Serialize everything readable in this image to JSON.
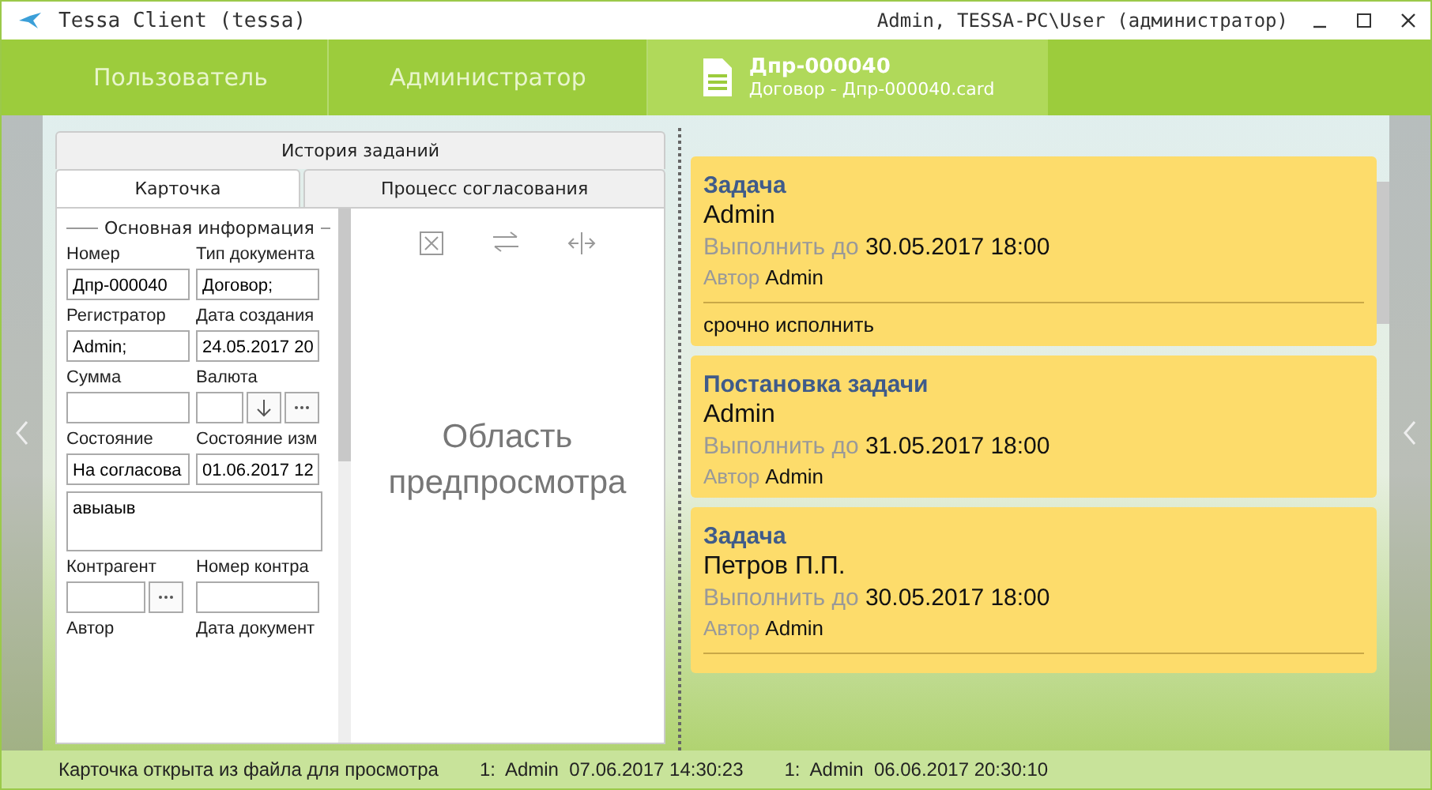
{
  "window": {
    "title": "Tessa Client (tessa)",
    "user": "Admin, TESSA-PC\\User (администратор)"
  },
  "tabs": [
    {
      "label": "Пользователь",
      "selected": false
    },
    {
      "label": "Администратор",
      "selected": false
    },
    {
      "label": "Дпр-000040",
      "subtitle": "Договор - Дпр-000040.card",
      "selected": true
    }
  ],
  "card_tabs_top": [
    {
      "label": "История заданий",
      "selected": false
    }
  ],
  "card_tabs": [
    {
      "label": "Карточка",
      "selected": true
    },
    {
      "label": "Процесс согласования",
      "selected": false
    }
  ],
  "section_title": "Основная информация",
  "fields": [
    {
      "label": "Номер",
      "value": "Дпр-000040",
      "kind": "text"
    },
    {
      "label": "Тип документа",
      "value": "Договор;",
      "kind": "text"
    },
    {
      "label": "Регистратор",
      "value": "Admin;",
      "kind": "text"
    },
    {
      "label": "Дата создания",
      "value": "24.05.2017  20",
      "kind": "text"
    },
    {
      "label": "Сумма",
      "kind": "text"
    },
    {
      "label": "Валюта",
      "kind": "currency"
    },
    {
      "label": "Состояние",
      "value": "На согласова",
      "kind": "text"
    },
    {
      "label": "Состояние изм",
      "value": "01.06.2017  12",
      "kind": "text"
    },
    {
      "value": "авыаыв",
      "kind": "memo"
    },
    {
      "label": "Контрагент",
      "kind": "lookup"
    },
    {
      "label": "Номер контра",
      "kind": "text"
    },
    {
      "label": "Автор",
      "kind": "cut"
    },
    {
      "label": "Дата документ",
      "kind": "cut"
    }
  ],
  "preview": {
    "text": "Область предпросмотра"
  },
  "tasks": [
    {
      "title": "Задача",
      "user": "Admin",
      "due_label": "Выполнить до",
      "due": "30.05.2017 18:00",
      "author_label": "Автор",
      "author": "Admin",
      "comment": "срочно исполнить"
    },
    {
      "title": "Постановка задачи",
      "user": "Admin",
      "due_label": "Выполнить до",
      "due": "31.05.2017 18:00",
      "author_label": "Автор",
      "author": "Admin"
    },
    {
      "title": "Задача",
      "user": "Петров П.П.",
      "due_label": "Выполнить до",
      "due": "30.05.2017 18:00",
      "author_label": "Автор",
      "author": "Admin"
    }
  ],
  "status_bar": {
    "message": "Карточка открыта из файла для просмотра",
    "locks": [
      {
        "count": "1:",
        "user": "Admin",
        "time": "07.06.2017 14:30:23"
      },
      {
        "count": "1:",
        "user": "Admin",
        "time": "06.06.2017 20:30:10"
      }
    ]
  }
}
